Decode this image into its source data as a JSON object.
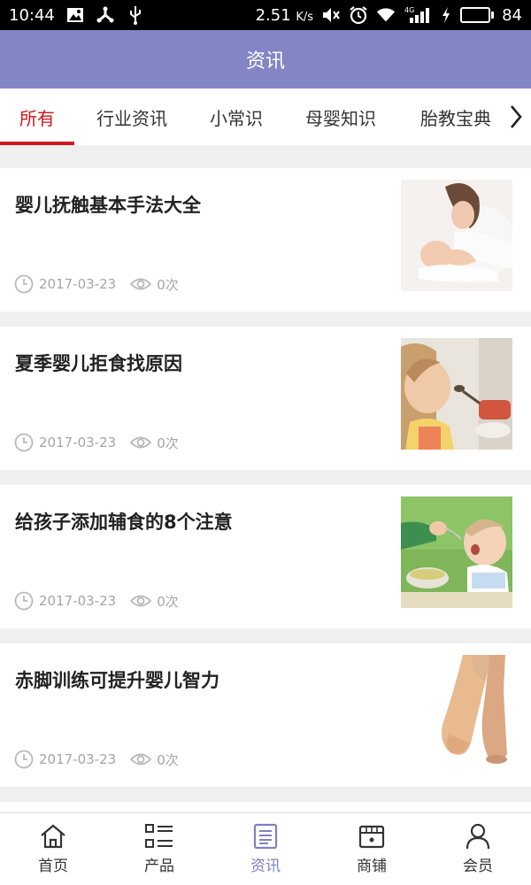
{
  "status_bar": {
    "time": "10:44",
    "speed": "2.51",
    "speed_unit": "K/s",
    "network": "4G",
    "battery": "84",
    "battery_level": 0.84,
    "battery_color": "#4cd630"
  },
  "header": {
    "title": "资讯",
    "color": "#8385c5"
  },
  "tabs": [
    {
      "label": "所有",
      "active": true
    },
    {
      "label": "行业资讯"
    },
    {
      "label": "小常识"
    },
    {
      "label": "母婴知识"
    },
    {
      "label": "胎教宝典"
    }
  ],
  "accent_color": "#d0161b",
  "news": [
    {
      "title": "婴儿抚触基本手法大全",
      "date": "2017-03-23",
      "views": "0次",
      "thumb": "mother-baby-photo"
    },
    {
      "title": "夏季婴儿拒食找原因",
      "date": "2017-03-23",
      "views": "0次",
      "thumb": "baby-spoon-photo"
    },
    {
      "title": "给孩子添加辅食的8个注意",
      "date": "2017-03-23",
      "views": "0次",
      "thumb": "baby-feeding-photo"
    },
    {
      "title": "赤脚训练可提升婴儿智力",
      "date": "2017-03-23",
      "views": "0次",
      "thumb": "baby-feet-photo"
    }
  ],
  "bottom_nav": [
    {
      "label": "首页",
      "icon": "home-icon"
    },
    {
      "label": "产品",
      "icon": "list-icon"
    },
    {
      "label": "资讯",
      "icon": "news-icon",
      "active": true
    },
    {
      "label": "商铺",
      "icon": "shop-icon"
    },
    {
      "label": "会员",
      "icon": "user-icon"
    }
  ]
}
